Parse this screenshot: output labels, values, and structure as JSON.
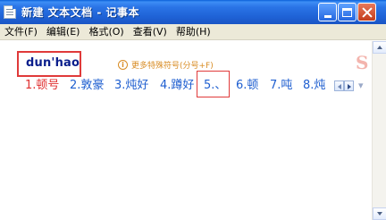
{
  "window": {
    "title": "新建 文本文档 - 记事本"
  },
  "menu": [
    {
      "label": "文件(F)"
    },
    {
      "label": "编辑(E)"
    },
    {
      "label": "格式(O)"
    },
    {
      "label": "查看(V)"
    },
    {
      "label": "帮助(H)"
    }
  ],
  "ime": {
    "pinyin": "dun'hao",
    "hint_icon": "i",
    "hint_text": "更多特殊符号(分号+F)",
    "candidates": [
      {
        "label": "1.顿号"
      },
      {
        "label": "2.敦豪"
      },
      {
        "label": "3.炖好"
      },
      {
        "label": "4.蹲好"
      },
      {
        "label": "5.、"
      },
      {
        "label": "6.顿"
      },
      {
        "label": "7.吨"
      },
      {
        "label": "8.炖"
      }
    ],
    "deco": "S"
  },
  "colors": {
    "titlebar": "#2a74e6",
    "first_candidate": "#e03030",
    "candidate": "#1f5fd0",
    "highlight_border": "#e03a3a",
    "hint": "#d88c24"
  },
  "icons": [
    "notepad-icon",
    "minimize-icon",
    "maximize-icon",
    "close-icon",
    "info-icon",
    "prev-page-icon",
    "next-page-icon",
    "chevron-down-icon",
    "scroll-up-icon",
    "scroll-down-icon"
  ]
}
